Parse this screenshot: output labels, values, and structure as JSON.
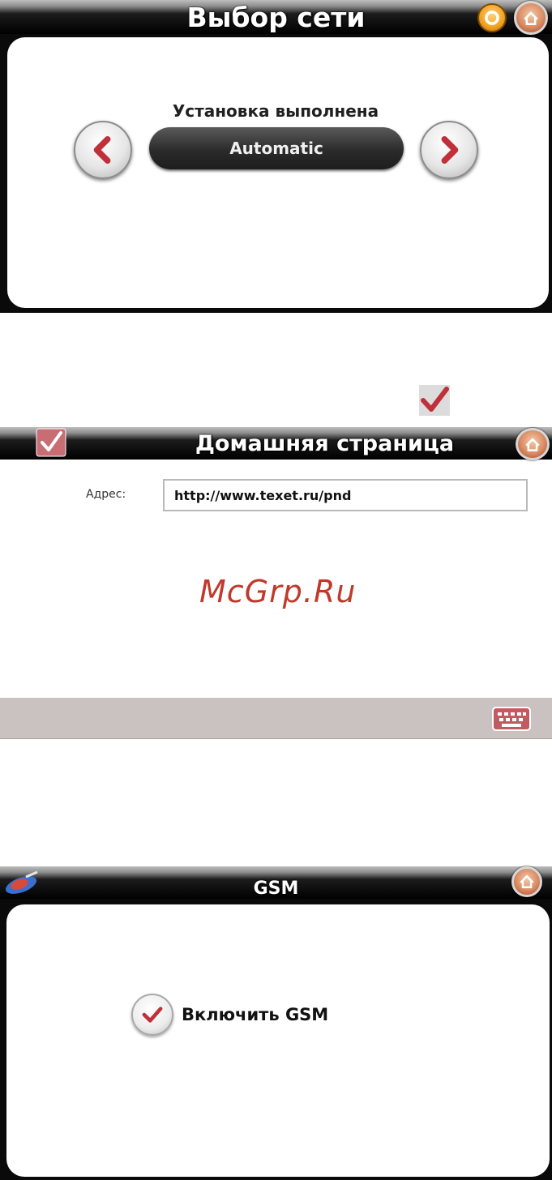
{
  "screen_network": {
    "title": "Выбор сети",
    "status_label": "Установка выполнена",
    "selected_value": "Automatic",
    "prev_icon": "chevron-left-icon",
    "next_icon": "chevron-right-icon",
    "settings_icon": "gear-icon",
    "home_icon": "home-icon"
  },
  "confirm_icon": "checkmark-icon",
  "screen_homepage": {
    "title": "Домашняя страница",
    "address_label": "Адрес:",
    "address_value": "http://www.texet.ru/pnd",
    "watermark": "McGrp.Ru",
    "keyboard_icon": "keyboard-icon",
    "confirm_icon": "checkmark-icon",
    "home_icon": "home-icon"
  },
  "screen_gsm": {
    "title": "GSM",
    "checkbox_label": "Включить GSM",
    "checkbox_checked": true,
    "satellite_icon": "satellite-icon",
    "home_icon": "home-icon"
  },
  "colors": {
    "accent_red": "#c0303a",
    "title_bar": "#000000",
    "pill": "#2b2b2b",
    "keyboard_bar": "#c9c2c0"
  }
}
